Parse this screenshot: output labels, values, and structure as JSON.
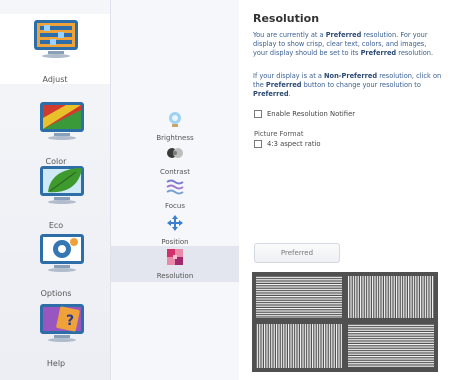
{
  "nav": {
    "items": [
      {
        "label": "Adjust",
        "active": true
      },
      {
        "label": "Color",
        "active": false
      },
      {
        "label": "Eco",
        "active": false
      },
      {
        "label": "Options",
        "active": false
      },
      {
        "label": "Help",
        "active": false
      }
    ]
  },
  "subnav": {
    "items": [
      {
        "label": "Brightness",
        "active": false
      },
      {
        "label": "Contrast",
        "active": false
      },
      {
        "label": "Focus",
        "active": false
      },
      {
        "label": "Position",
        "active": false
      },
      {
        "label": "Resolution",
        "active": true
      }
    ]
  },
  "content": {
    "title": "Resolution",
    "para1": {
      "t1": "You are currently at a ",
      "b1": "Preferred",
      "t2": " resolution. For your display to show crisp, clear text, colors, and images, your display should be set to its ",
      "b2": "Preferred",
      "t3": " resolution."
    },
    "para2": {
      "t1": "If your display is at a ",
      "b1": "Non-Preferred",
      "t2": " resolution, click on the ",
      "b2": "Preferred",
      "t3": " button to change your resolution to ",
      "b3": "Preferred",
      "t4": "."
    },
    "enable_notifier_label": "Enable Resolution Notifier",
    "enable_notifier_checked": false,
    "picture_format_label": "Picture Format",
    "aspect_label": "4:3 aspect ratio",
    "aspect_checked": false,
    "preferred_button": "Preferred"
  },
  "colors": {
    "text_blue": "#3a5f90",
    "nav_bg": "#eceef4",
    "active_sub_bg": "#e4e6ef"
  },
  "icons": [
    "monitor-adjust-icon",
    "monitor-color-icon",
    "monitor-eco-icon",
    "monitor-options-icon",
    "monitor-help-icon",
    "brightness-icon",
    "contrast-icon",
    "focus-icon",
    "position-icon",
    "resolution-icon"
  ]
}
